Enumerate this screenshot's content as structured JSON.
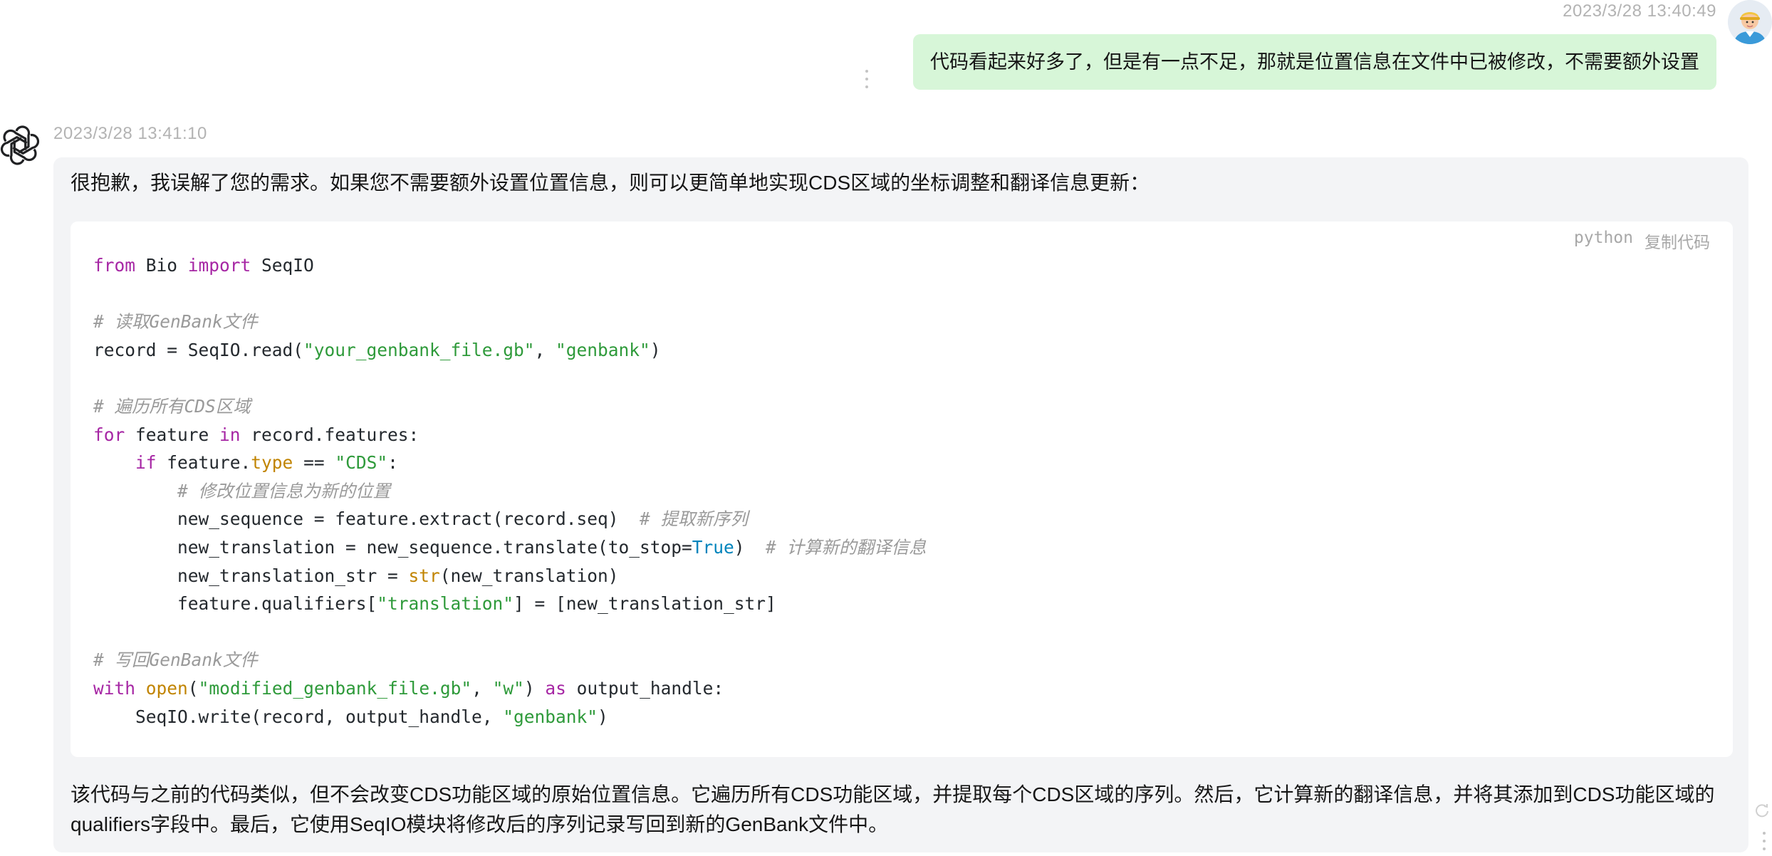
{
  "user_message": {
    "timestamp": "2023/3/28 13:40:49",
    "text": "代码看起来好多了，但是有一点不足，那就是位置信息在文件中已被修改，不需要额外设置",
    "bubble_color": "#d7f6d8",
    "avatar": "user-avatar"
  },
  "assistant_message": {
    "timestamp": "2023/3/28 13:41:10",
    "avatar": "openai-logo-icon",
    "intro": "很抱歉，我误解了您的需求。如果您不需要额外设置位置信息，则可以更简单地实现CDS区域的坐标调整和翻译信息更新：",
    "code_block": {
      "language": "python",
      "copy_label": "复制代码",
      "lines": [
        "from Bio import SeqIO",
        "",
        "# 读取GenBank文件",
        "record = SeqIO.read(\"your_genbank_file.gb\", \"genbank\")",
        "",
        "# 遍历所有CDS区域",
        "for feature in record.features:",
        "    if feature.type == \"CDS\":",
        "        # 修改位置信息为新的位置",
        "        new_sequence = feature.extract(record.seq)  # 提取新序列",
        "        new_translation = new_sequence.translate(to_stop=True)  # 计算新的翻译信息",
        "        new_translation_str = str(new_translation)",
        "        feature.qualifiers[\"translation\"] = [new_translation_str]",
        "",
        "# 写回GenBank文件",
        "with open(\"modified_genbank_file.gb\", \"w\") as output_handle:",
        "    SeqIO.write(record, output_handle, \"genbank\")"
      ]
    },
    "summary": "该代码与之前的代码类似，但不会改变CDS功能区域的原始位置信息。它遍历所有CDS功能区域，并提取每个CDS区域的序列。然后，它计算新的翻译信息，并将其添加到CDS功能区域的qualifiers字段中。最后，它使用SeqIO模块将修改后的序列记录写回到新的GenBank文件中。",
    "card_color": "#f3f4f6"
  },
  "colors": {
    "keyword": "#a626a4",
    "string": "#2e9a3a",
    "builtin": "#c18401",
    "comment": "#9a9a9a",
    "boolean": "#0184bc"
  }
}
